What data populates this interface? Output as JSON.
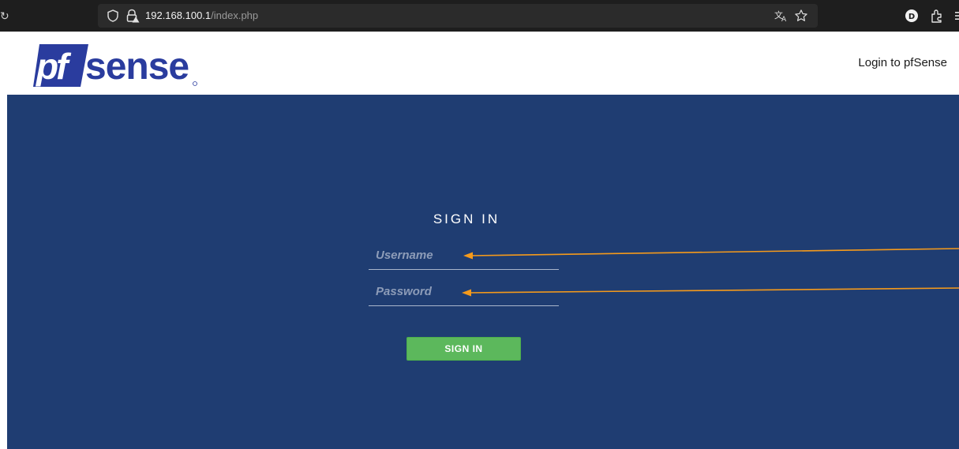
{
  "browser": {
    "url_host": "192.168.100.1",
    "url_path": "/index.php",
    "profile_initial": "D",
    "icons": [
      "reload-icon",
      "shield-icon",
      "lock-warning-icon",
      "translate-icon",
      "bookmark-star-icon",
      "profile-icon",
      "extensions-icon",
      "menu-icon"
    ]
  },
  "header": {
    "logo_text": "pfsense",
    "login_link": "Login to pfSense"
  },
  "login": {
    "title": "SIGN IN",
    "username_placeholder": "Username",
    "password_placeholder": "Password",
    "button_label": "SIGN IN"
  },
  "colors": {
    "panel": "#1f3d72",
    "button": "#5cb85c",
    "annotation_arrow": "#f59a1b",
    "logo_blue": "#2a3c9e"
  }
}
